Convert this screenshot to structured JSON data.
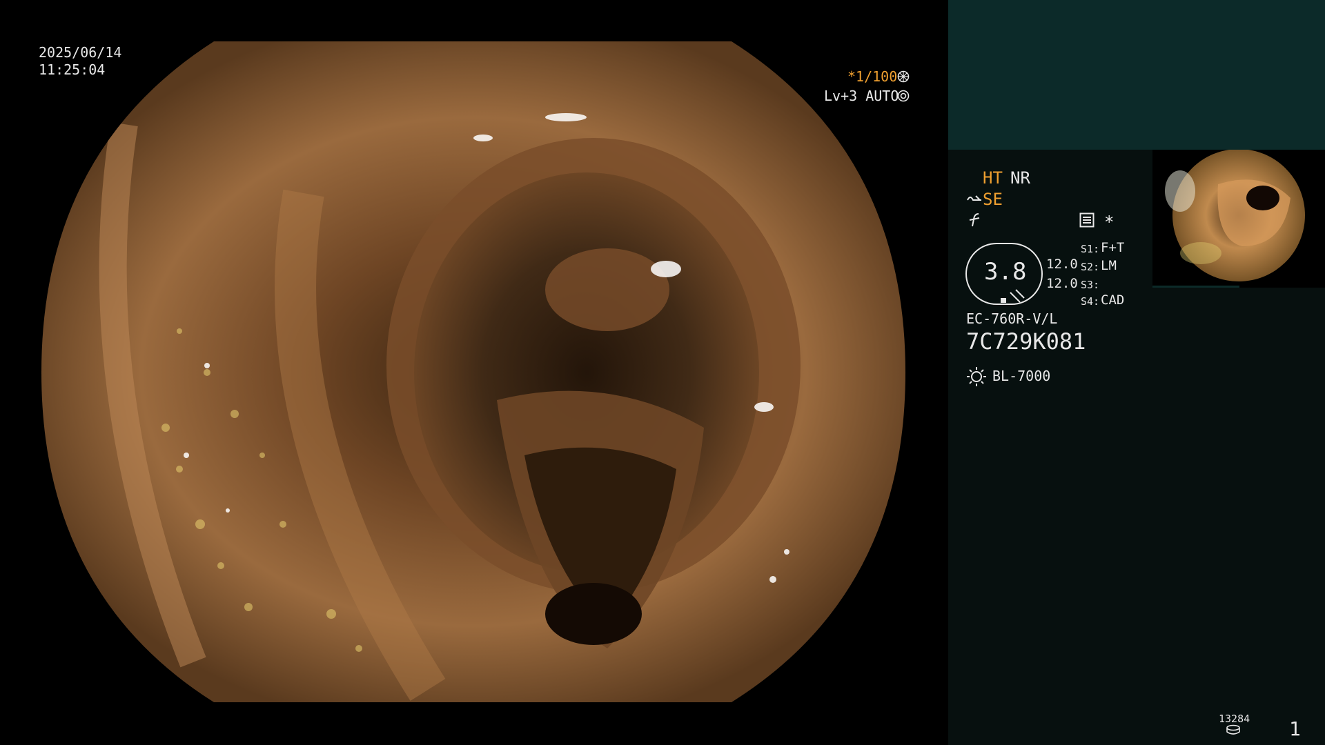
{
  "overlay": {
    "date": "2025/06/14",
    "time": "11:25:04",
    "shutter": "*1/100",
    "level": "Lv+3 AUTO"
  },
  "panel": {
    "ht": "HT",
    "nr": "NR",
    "se": "SE",
    "asterisk": "*",
    "zoom_value": "3.8",
    "val1": "12.0",
    "val2": "12.0",
    "s1_label": "S1:",
    "s1_value": "F+T",
    "s2_label": "S2:",
    "s2_value": "LM",
    "s3_label": "S3:",
    "s3_value": "",
    "s4_label": "S4:",
    "s4_value": "CAD",
    "scope_model": "EC-760R-V/L",
    "serial": "7C729K081",
    "light_source": "BL-7000",
    "counter": "13284",
    "page": "1"
  },
  "colors": {
    "accent": "#f0a030",
    "panel_top": "#0c2a29",
    "panel_bg": "#07100f",
    "tissue": "#8a5a30"
  },
  "icons": {
    "shutter_icon": "aperture-icon",
    "level_icon": "iris-icon",
    "se_icon": "enhance-icon",
    "f_icon": "freeze-icon",
    "menu_icon": "menu-icon",
    "light_icon": "sun-icon",
    "storage_icon": "disk-icon"
  }
}
